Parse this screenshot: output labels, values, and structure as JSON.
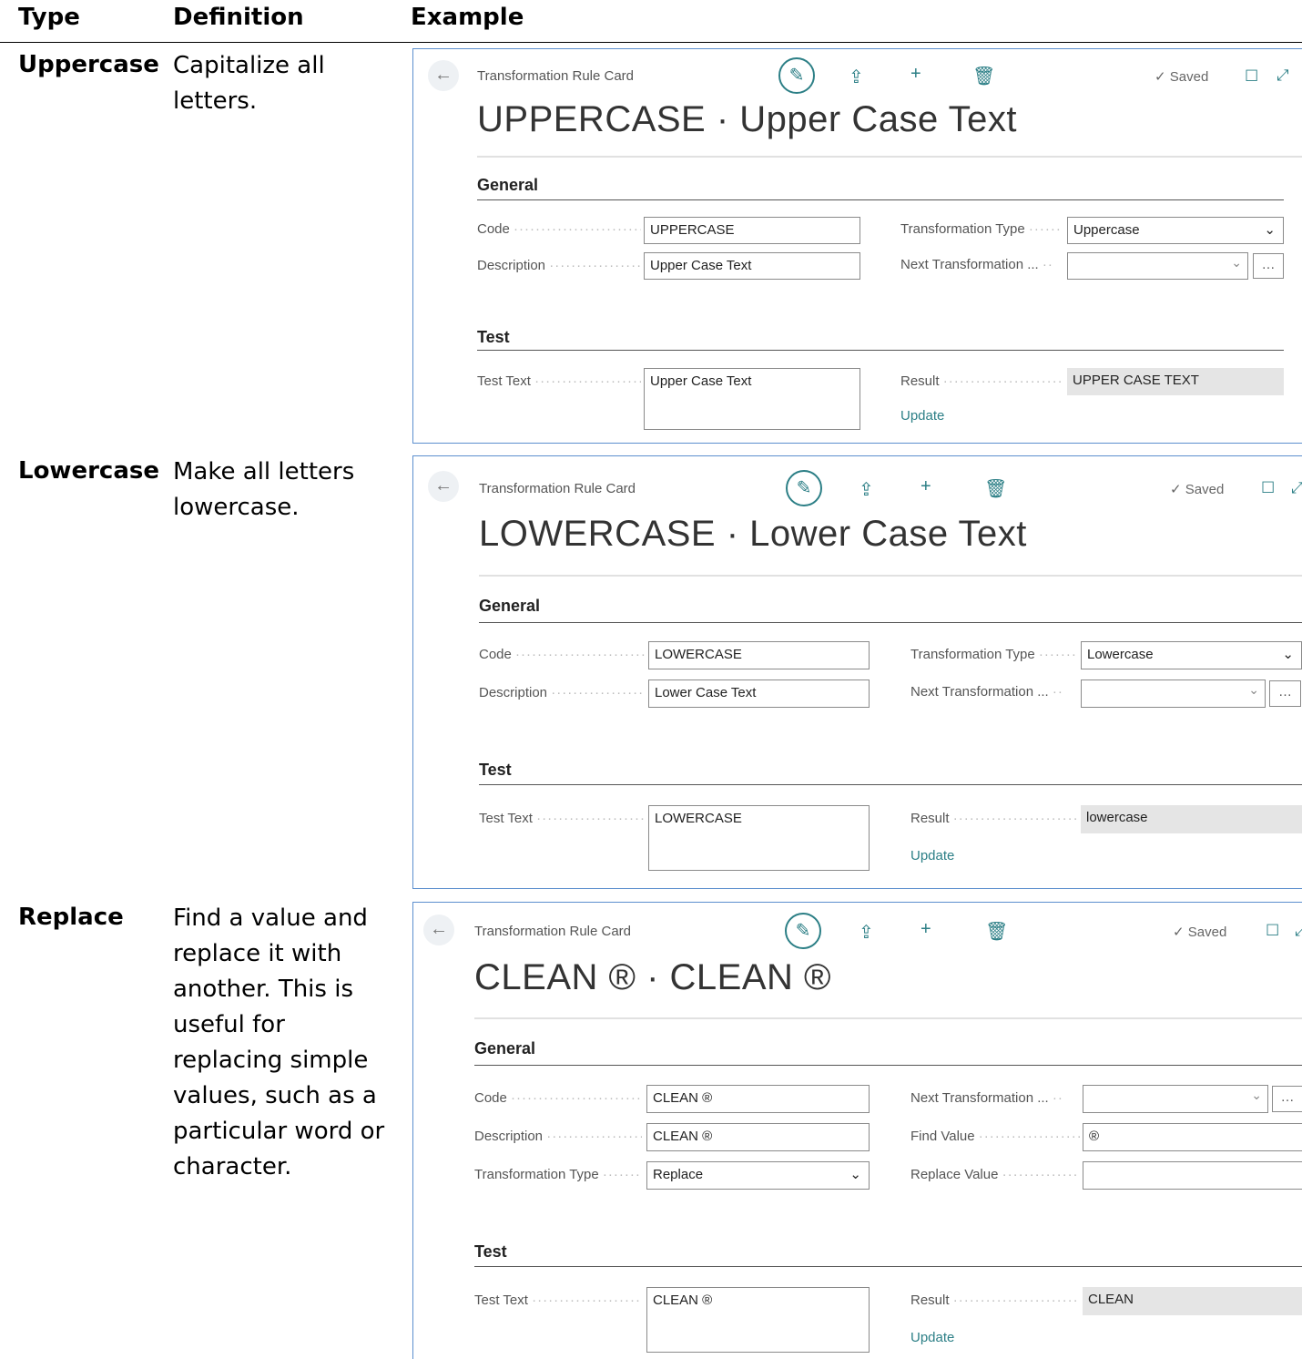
{
  "headers": {
    "type": "Type",
    "definition": "Definition",
    "example": "Example"
  },
  "rows": [
    {
      "type": "Uppercase",
      "definition": "Capitalize all letters.",
      "card": {
        "breadcrumb": "Transformation Rule Card",
        "saved": "Saved",
        "title": "UPPERCASE · Upper Case Text",
        "general": "General",
        "test": "Test",
        "code_label": "Code",
        "code_value": "UPPERCASE",
        "description_label": "Description",
        "description_value": "Upper Case Text",
        "type_label": "Transformation Type",
        "type_value": "Uppercase",
        "next_label": "Next Transformation ...",
        "next_value": "",
        "test_text_label": "Test Text",
        "test_text_value": "Upper Case Text",
        "result_label": "Result",
        "result_value": "UPPER CASE TEXT",
        "update": "Update"
      }
    },
    {
      "type": "Lowercase",
      "definition": "Make all letters lowercase.",
      "card": {
        "breadcrumb": "Transformation Rule Card",
        "saved": "Saved",
        "title": "LOWERCASE · Lower Case Text",
        "general": "General",
        "test": "Test",
        "code_label": "Code",
        "code_value": "LOWERCASE",
        "description_label": "Description",
        "description_value": "Lower Case Text",
        "type_label": "Transformation Type",
        "type_value": "Lowercase",
        "next_label": "Next Transformation ...",
        "next_value": "",
        "test_text_label": "Test Text",
        "test_text_value": "LOWERCASE",
        "result_label": "Result",
        "result_value": "lowercase",
        "update": "Update"
      }
    },
    {
      "type": "Replace",
      "definition": "Find a value and replace it with another. This is useful for replacing simple values, such as a particular word or character.",
      "card": {
        "breadcrumb": "Transformation Rule Card",
        "saved": "Saved",
        "title": "CLEAN ® · CLEAN ®",
        "general": "General",
        "test": "Test",
        "code_label": "Code",
        "code_value": "CLEAN ®",
        "description_label": "Description",
        "description_value": "CLEAN ®",
        "type_label": "Transformation Type",
        "type_value": "Replace",
        "next_label": "Next Transformation ...",
        "next_value": "",
        "find_label": "Find Value",
        "find_value": "®",
        "replace_label": "Replace Value",
        "replace_value": "",
        "test_text_label": "Test Text",
        "test_text_value": "CLEAN ®",
        "result_label": "Result",
        "result_value": "CLEAN",
        "update": "Update"
      }
    }
  ]
}
